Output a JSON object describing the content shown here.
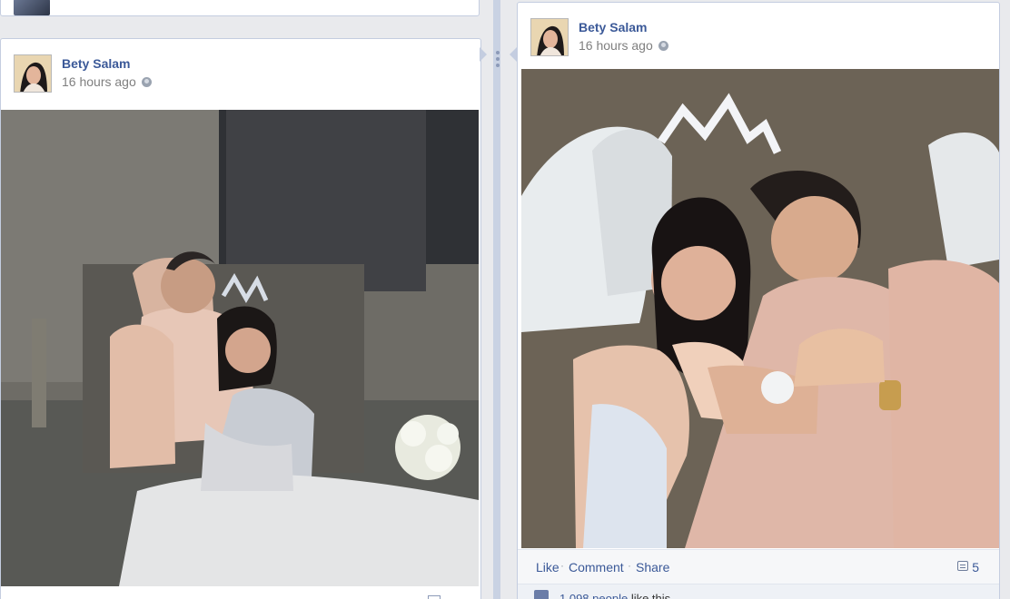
{
  "left_post": {
    "author": "Bety Salam",
    "time": "16 hours ago",
    "avatar_icon": "profile-photo",
    "privacy_icon": "globe-icon",
    "photo_icon": "wedding-photo"
  },
  "right_post": {
    "author": "Bety Salam",
    "time": "16 hours ago",
    "avatar_icon": "profile-photo",
    "privacy_icon": "globe-icon",
    "photo_icon": "wedding-photo",
    "actions": {
      "like": "Like",
      "comment": "Comment",
      "share": "Share",
      "separator": "·"
    },
    "comments_count": "5",
    "likes": {
      "count_text": "1,098 people",
      "suffix": "like this."
    }
  }
}
